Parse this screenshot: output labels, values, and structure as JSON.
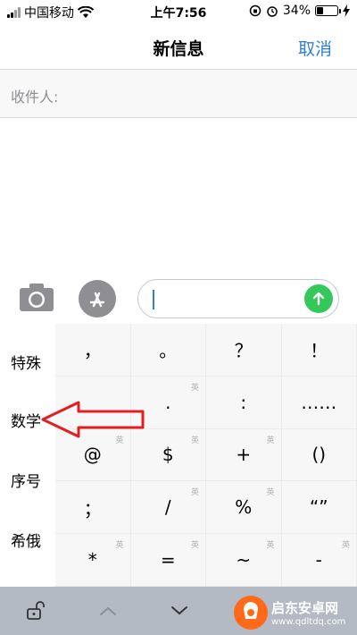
{
  "status_bar": {
    "carrier": "中国移动",
    "time": "上午7:56",
    "battery": "34%",
    "battery_level": 0.34
  },
  "nav": {
    "title": "新信息",
    "cancel_label": "取消"
  },
  "recipient": {
    "label": "收件人:"
  },
  "keyboard": {
    "categories": [
      "特殊",
      "数学",
      "序号",
      "希俄"
    ],
    "keys": [
      [
        {
          "char": "，",
          "hint": ""
        },
        {
          "char": "。",
          "hint": ""
        },
        {
          "char": "？",
          "hint": ""
        },
        {
          "char": "！",
          "hint": ""
        }
      ],
      [
        {
          "char": "",
          "hint": ""
        },
        {
          "char": ".",
          "hint": "英"
        },
        {
          "char": ":",
          "hint": ""
        },
        {
          "char": "……",
          "hint": ""
        }
      ],
      [
        {
          "char": "@",
          "hint": "英"
        },
        {
          "char": "$",
          "hint": "英"
        },
        {
          "char": "+",
          "hint": "英"
        },
        {
          "char": "()",
          "hint": ""
        }
      ],
      [
        {
          "char": "；",
          "hint": ""
        },
        {
          "char": "/",
          "hint": "英"
        },
        {
          "char": "%",
          "hint": "英"
        },
        {
          "char": "“”",
          "hint": ""
        }
      ],
      [
        {
          "char": "*",
          "hint": "英"
        },
        {
          "char": "=",
          "hint": "英"
        },
        {
          "char": "~",
          "hint": "英"
        },
        {
          "char": "-",
          "hint": "英"
        }
      ]
    ]
  },
  "watermark": {
    "name": "启东安卓网",
    "url": "www.qdltdq.com"
  },
  "colors": {
    "accent": "#2f7fd8",
    "send": "#34c759",
    "toolbar": "#b4bac4",
    "arrow": "#e02020"
  },
  "icons": {
    "camera": "camera-icon",
    "apps": "app-store-icon",
    "send": "arrow-up-icon",
    "lock": "unlock-icon",
    "up": "chevron-up-icon",
    "down": "chevron-down-icon"
  }
}
